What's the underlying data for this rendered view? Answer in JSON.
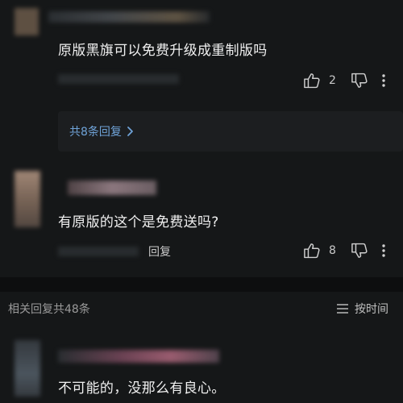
{
  "comments": [
    {
      "text": "原版黑旗可以免费升级成重制版吗",
      "likes": "2",
      "replies_link": "共8条回复"
    },
    {
      "text": "有原版的这个是免费送吗?",
      "reply_label": "回复",
      "likes": "8"
    }
  ],
  "related": {
    "summary": "相关回复共48条",
    "sort_label": "按时间"
  },
  "reply": {
    "text": "不可能的，没那么有良心。"
  },
  "colors": {
    "background": "#151718",
    "link": "#6fa3d8",
    "divider": "#0d0e0f"
  },
  "icons": [
    "thumb-up-icon",
    "thumb-down-icon",
    "more-icon",
    "chevron-right-icon",
    "sort-icon"
  ]
}
